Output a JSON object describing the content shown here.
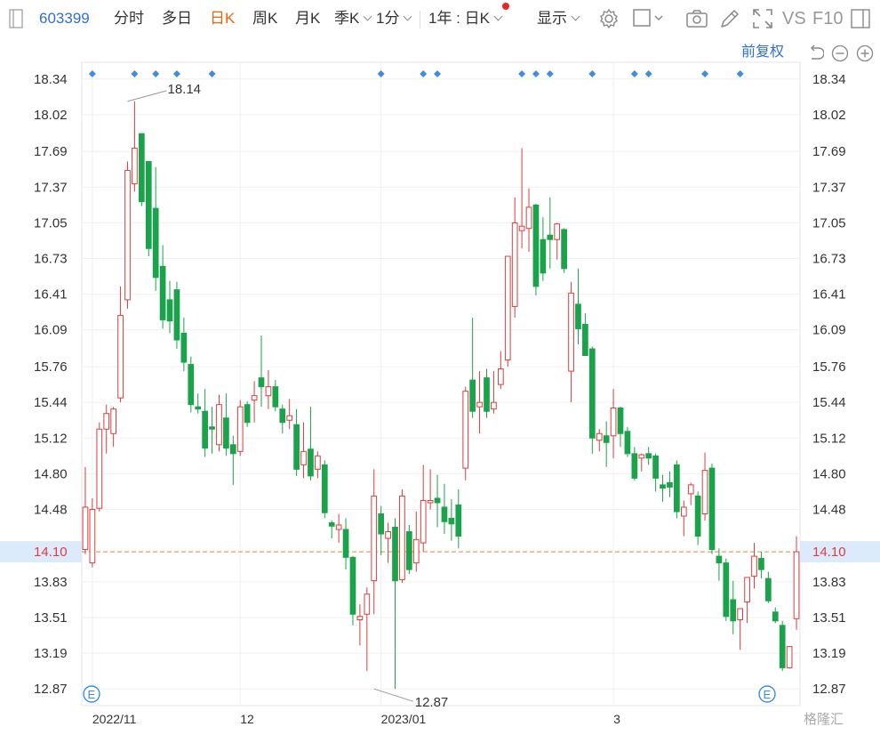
{
  "toolbar": {
    "stock_code": "603399",
    "tabs": [
      "分时",
      "多日",
      "日K",
      "周K",
      "月K"
    ],
    "active_tab": "日K",
    "season_label": "季K",
    "minute_label": "1分",
    "range_label": "1年 : 日K",
    "display_label": "显示",
    "vs_label": "VS",
    "f10_label": "F10"
  },
  "controls": {
    "adjust_label": "前复权"
  },
  "watermark": "格隆汇",
  "colors": {
    "up": "#e03c3c",
    "down": "#1aa34a",
    "accent": "#2f6fd1",
    "price_line": "#e08a3c",
    "price_badge_bg": "#dcebfc",
    "price_text": "#e03c3c"
  },
  "chart_data": {
    "type": "candlestick",
    "title": "",
    "ylim": [
      12.72,
      18.49
    ],
    "y_ticks": [
      "18.34",
      "18.02",
      "17.69",
      "17.37",
      "17.05",
      "16.73",
      "16.41",
      "16.09",
      "15.76",
      "15.44",
      "15.12",
      "14.80",
      "14.48",
      "14.10",
      "13.83",
      "13.51",
      "13.19",
      "12.87"
    ],
    "x_labels": [
      {
        "label": "2022/11",
        "index": 1
      },
      {
        "label": "12",
        "index": 22
      },
      {
        "label": "2023/01",
        "index": 42
      },
      {
        "label": "3",
        "index": 75
      }
    ],
    "last_price": "14.10",
    "annotations": [
      {
        "label": "18.14",
        "type": "max",
        "index": 6,
        "value": 18.14
      },
      {
        "label": "12.87",
        "type": "min",
        "index": 41,
        "value": 12.87
      }
    ],
    "event_marker_label": "E",
    "event_marker_indices": [
      0,
      95
    ],
    "marker_indices": [
      1,
      7,
      10,
      13,
      18,
      42,
      48,
      50,
      62,
      64,
      66,
      72,
      78,
      80,
      88,
      93
    ],
    "candles": [
      {
        "o": 14.12,
        "h": 14.86,
        "l": 14.08,
        "c": 14.5
      },
      {
        "o": 14.0,
        "h": 14.58,
        "l": 13.96,
        "c": 14.48
      },
      {
        "o": 14.49,
        "h": 15.26,
        "l": 14.46,
        "c": 15.2
      },
      {
        "o": 15.2,
        "h": 15.42,
        "l": 14.98,
        "c": 15.34
      },
      {
        "o": 15.16,
        "h": 15.4,
        "l": 15.04,
        "c": 15.38
      },
      {
        "o": 15.48,
        "h": 16.48,
        "l": 15.44,
        "c": 16.22
      },
      {
        "o": 16.36,
        "h": 17.6,
        "l": 16.28,
        "c": 17.52
      },
      {
        "o": 17.4,
        "h": 18.14,
        "l": 17.33,
        "c": 17.72
      },
      {
        "o": 17.85,
        "h": 17.85,
        "l": 17.2,
        "c": 17.24
      },
      {
        "o": 17.6,
        "h": 17.6,
        "l": 16.75,
        "c": 16.82
      },
      {
        "o": 17.18,
        "h": 17.55,
        "l": 16.44,
        "c": 16.56
      },
      {
        "o": 16.66,
        "h": 16.85,
        "l": 16.1,
        "c": 16.18
      },
      {
        "o": 16.36,
        "h": 16.53,
        "l": 16.06,
        "c": 16.17
      },
      {
        "o": 16.45,
        "h": 16.52,
        "l": 15.92,
        "c": 16.0
      },
      {
        "o": 16.06,
        "h": 16.2,
        "l": 15.72,
        "c": 15.8
      },
      {
        "o": 15.78,
        "h": 15.85,
        "l": 15.35,
        "c": 15.42
      },
      {
        "o": 15.4,
        "h": 15.52,
        "l": 15.34,
        "c": 15.38
      },
      {
        "o": 15.36,
        "h": 15.56,
        "l": 14.95,
        "c": 15.03
      },
      {
        "o": 15.22,
        "h": 15.4,
        "l": 14.98,
        "c": 15.2
      },
      {
        "o": 15.06,
        "h": 15.51,
        "l": 15.0,
        "c": 15.42
      },
      {
        "o": 15.3,
        "h": 15.52,
        "l": 14.96,
        "c": 15.03
      },
      {
        "o": 15.06,
        "h": 15.14,
        "l": 14.7,
        "c": 14.98
      },
      {
        "o": 15.0,
        "h": 15.46,
        "l": 14.96,
        "c": 15.4
      },
      {
        "o": 15.42,
        "h": 15.45,
        "l": 15.22,
        "c": 15.26
      },
      {
        "o": 15.46,
        "h": 15.63,
        "l": 15.26,
        "c": 15.5
      },
      {
        "o": 15.66,
        "h": 16.04,
        "l": 15.4,
        "c": 15.58
      },
      {
        "o": 15.5,
        "h": 15.73,
        "l": 15.38,
        "c": 15.58
      },
      {
        "o": 15.58,
        "h": 15.64,
        "l": 15.36,
        "c": 15.4
      },
      {
        "o": 15.38,
        "h": 15.42,
        "l": 15.16,
        "c": 15.26
      },
      {
        "o": 15.28,
        "h": 15.47,
        "l": 15.2,
        "c": 15.32
      },
      {
        "o": 15.24,
        "h": 15.38,
        "l": 14.78,
        "c": 14.84
      },
      {
        "o": 14.88,
        "h": 15.26,
        "l": 14.76,
        "c": 15.0
      },
      {
        "o": 15.02,
        "h": 15.4,
        "l": 14.74,
        "c": 14.78
      },
      {
        "o": 14.84,
        "h": 15.0,
        "l": 14.76,
        "c": 14.96
      },
      {
        "o": 14.88,
        "h": 14.92,
        "l": 14.4,
        "c": 14.45
      },
      {
        "o": 14.36,
        "h": 14.38,
        "l": 14.22,
        "c": 14.33
      },
      {
        "o": 14.3,
        "h": 14.44,
        "l": 14.18,
        "c": 14.34
      },
      {
        "o": 14.3,
        "h": 14.4,
        "l": 13.94,
        "c": 14.05
      },
      {
        "o": 14.05,
        "h": 14.06,
        "l": 13.44,
        "c": 13.54
      },
      {
        "o": 13.49,
        "h": 13.63,
        "l": 13.26,
        "c": 13.52
      },
      {
        "o": 13.54,
        "h": 13.78,
        "l": 13.03,
        "c": 13.72
      },
      {
        "o": 13.84,
        "h": 14.84,
        "l": 13.54,
        "c": 14.6
      },
      {
        "o": 14.44,
        "h": 14.51,
        "l": 14.07,
        "c": 14.26
      },
      {
        "o": 14.22,
        "h": 14.36,
        "l": 14.0,
        "c": 14.28
      },
      {
        "o": 14.32,
        "h": 14.4,
        "l": 12.87,
        "c": 13.84
      },
      {
        "o": 13.85,
        "h": 14.66,
        "l": 13.82,
        "c": 14.6
      },
      {
        "o": 14.28,
        "h": 14.34,
        "l": 13.9,
        "c": 13.94
      },
      {
        "o": 14.0,
        "h": 14.46,
        "l": 13.92,
        "c": 14.21
      },
      {
        "o": 14.18,
        "h": 14.88,
        "l": 14.1,
        "c": 14.56
      },
      {
        "o": 14.54,
        "h": 14.84,
        "l": 14.48,
        "c": 14.56
      },
      {
        "o": 14.58,
        "h": 14.79,
        "l": 14.32,
        "c": 14.54
      },
      {
        "o": 14.5,
        "h": 14.71,
        "l": 14.26,
        "c": 14.37
      },
      {
        "o": 14.4,
        "h": 14.57,
        "l": 14.2,
        "c": 14.35
      },
      {
        "o": 14.52,
        "h": 14.66,
        "l": 14.13,
        "c": 14.24
      },
      {
        "o": 14.85,
        "h": 15.58,
        "l": 14.74,
        "c": 15.54
      },
      {
        "o": 15.64,
        "h": 16.2,
        "l": 15.3,
        "c": 15.36
      },
      {
        "o": 15.4,
        "h": 15.72,
        "l": 15.16,
        "c": 15.44
      },
      {
        "o": 15.66,
        "h": 15.74,
        "l": 15.3,
        "c": 15.36
      },
      {
        "o": 15.38,
        "h": 15.72,
        "l": 15.34,
        "c": 15.44
      },
      {
        "o": 15.6,
        "h": 15.9,
        "l": 15.56,
        "c": 15.74
      },
      {
        "o": 15.82,
        "h": 16.22,
        "l": 15.76,
        "c": 16.75
      },
      {
        "o": 16.3,
        "h": 17.28,
        "l": 16.2,
        "c": 17.05
      },
      {
        "o": 16.98,
        "h": 17.72,
        "l": 16.82,
        "c": 17.02
      },
      {
        "o": 17.0,
        "h": 17.36,
        "l": 16.79,
        "c": 17.19
      },
      {
        "o": 17.21,
        "h": 17.22,
        "l": 16.4,
        "c": 16.48
      },
      {
        "o": 16.9,
        "h": 17.1,
        "l": 16.53,
        "c": 16.6
      },
      {
        "o": 16.94,
        "h": 17.28,
        "l": 16.64,
        "c": 16.9
      },
      {
        "o": 16.9,
        "h": 17.05,
        "l": 16.72,
        "c": 17.04
      },
      {
        "o": 16.99,
        "h": 17.0,
        "l": 16.6,
        "c": 16.64
      },
      {
        "o": 15.72,
        "h": 16.52,
        "l": 15.44,
        "c": 16.42
      },
      {
        "o": 16.32,
        "h": 16.64,
        "l": 15.96,
        "c": 16.1
      },
      {
        "o": 16.14,
        "h": 16.24,
        "l": 15.94,
        "c": 15.86
      },
      {
        "o": 15.92,
        "h": 15.94,
        "l": 14.98,
        "c": 15.12
      },
      {
        "o": 15.1,
        "h": 15.2,
        "l": 15.0,
        "c": 15.16
      },
      {
        "o": 15.14,
        "h": 15.27,
        "l": 14.86,
        "c": 15.08
      },
      {
        "o": 15.14,
        "h": 15.56,
        "l": 14.94,
        "c": 15.39
      },
      {
        "o": 15.39,
        "h": 15.4,
        "l": 15.04,
        "c": 15.16
      },
      {
        "o": 15.18,
        "h": 15.22,
        "l": 14.95,
        "c": 14.98
      },
      {
        "o": 14.98,
        "h": 15.04,
        "l": 14.74,
        "c": 14.76
      },
      {
        "o": 14.94,
        "h": 14.98,
        "l": 14.82,
        "c": 14.97
      },
      {
        "o": 14.98,
        "h": 15.04,
        "l": 14.88,
        "c": 14.94
      },
      {
        "o": 14.96,
        "h": 14.98,
        "l": 14.64,
        "c": 14.76
      },
      {
        "o": 14.7,
        "h": 14.79,
        "l": 14.55,
        "c": 14.67
      },
      {
        "o": 14.72,
        "h": 14.82,
        "l": 14.59,
        "c": 14.68
      },
      {
        "o": 14.88,
        "h": 14.92,
        "l": 14.4,
        "c": 14.46
      },
      {
        "o": 14.42,
        "h": 14.56,
        "l": 14.24,
        "c": 14.5
      },
      {
        "o": 14.62,
        "h": 14.72,
        "l": 14.52,
        "c": 14.7
      },
      {
        "o": 14.6,
        "h": 14.64,
        "l": 14.16,
        "c": 14.24
      },
      {
        "o": 14.44,
        "h": 14.99,
        "l": 14.38,
        "c": 14.83
      },
      {
        "o": 14.85,
        "h": 14.89,
        "l": 14.08,
        "c": 14.12
      },
      {
        "o": 14.06,
        "h": 14.13,
        "l": 13.84,
        "c": 14.0
      },
      {
        "o": 14.0,
        "h": 14.04,
        "l": 13.48,
        "c": 13.52
      },
      {
        "o": 13.67,
        "h": 13.84,
        "l": 13.36,
        "c": 13.48
      },
      {
        "o": 13.49,
        "h": 13.56,
        "l": 13.22,
        "c": 13.59
      },
      {
        "o": 13.65,
        "h": 13.87,
        "l": 13.46,
        "c": 13.87
      },
      {
        "o": 13.88,
        "h": 14.18,
        "l": 13.77,
        "c": 14.06
      },
      {
        "o": 14.04,
        "h": 14.1,
        "l": 13.86,
        "c": 13.94
      },
      {
        "o": 13.86,
        "h": 13.92,
        "l": 13.64,
        "c": 13.66
      },
      {
        "o": 13.56,
        "h": 13.6,
        "l": 13.46,
        "c": 13.48
      },
      {
        "o": 13.44,
        "h": 13.48,
        "l": 13.03,
        "c": 13.06
      },
      {
        "o": 13.06,
        "h": 13.25,
        "l": 13.05,
        "c": 13.25
      },
      {
        "o": 13.5,
        "h": 14.24,
        "l": 13.4,
        "c": 14.1
      }
    ]
  }
}
